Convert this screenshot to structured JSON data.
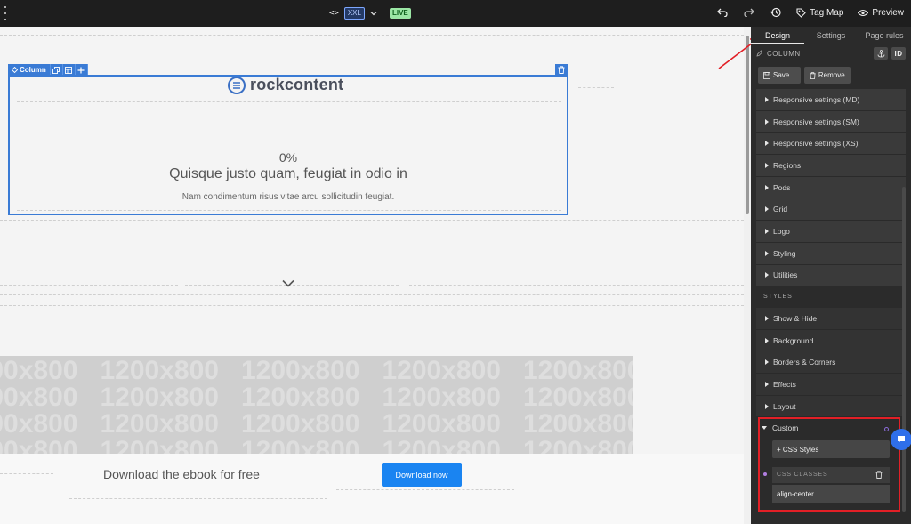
{
  "toolbar": {
    "code_glyph": "<>",
    "breakpoint": "XXL",
    "status": "LIVE",
    "tag_map_label": "Tag Map",
    "preview_label": "Preview"
  },
  "canvas": {
    "column_tag": "Column",
    "logo_text": "rockcontent",
    "percent": "0%",
    "headline": "Quisque justo quam, feugiat in odio in",
    "subline": "Nam condimentum risus vitae arcu sollicitudin feugiat.",
    "placeholder_text": "1200x800",
    "cta_text": "Download the ebook for free",
    "cta_button": "Download now"
  },
  "panel": {
    "tabs": [
      "Design",
      "Settings",
      "Page rules"
    ],
    "active_tab": "Design",
    "element_title": "COLUMN",
    "id_label": "ID",
    "save_label": "Save...",
    "remove_label": "Remove",
    "settings_items": [
      "Responsive settings (MD)",
      "Responsive settings (SM)",
      "Responsive settings (XS)",
      "Regions",
      "Pods",
      "Grid",
      "Logo",
      "Styling",
      "Utilities"
    ],
    "styles_label": "STYLES",
    "style_items": [
      "Show & Hide",
      "Background",
      "Borders & Corners",
      "Effects",
      "Layout"
    ],
    "custom_label": "Custom",
    "css_styles_label": "+ CSS Styles",
    "css_classes_label": "CSS CLASSES",
    "css_class_value": "align-center"
  },
  "colors": {
    "accent_blue": "#3a7bd5",
    "cta_blue": "#1a84f1",
    "highlight_red": "#e21f26",
    "live_green": "#9be7a5"
  }
}
